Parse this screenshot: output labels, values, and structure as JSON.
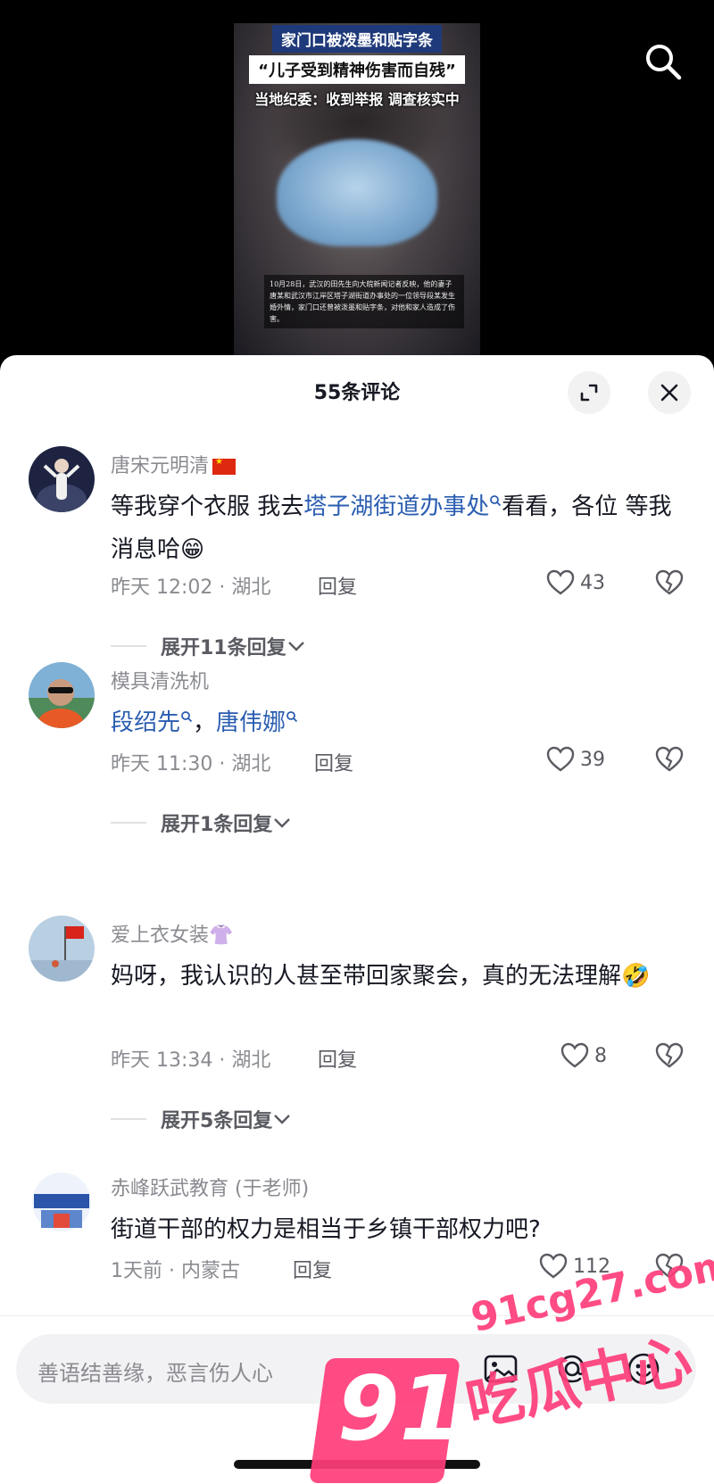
{
  "video": {
    "headline_1": "家门口被泼墨和贴字条",
    "headline_2": "“儿子受到精神伤害而自残”",
    "headline_3": "当地纪委：收到举报 调查核实中",
    "caption": "10月28日，武汉的田先生向大皖新闻记者反映，他的妻子唐某和武汉市江岸区塔子湖街道办事处的一位领导段某发生婚外情，家门口还曾被泼墨和贴字条，对他和家人造成了伤害。"
  },
  "sheet": {
    "title": "55条评论"
  },
  "comments": [
    {
      "username": "唐宋元明清",
      "text_pre": "等我穿个衣服 我去",
      "link_1": "塔子湖街道办事处",
      "text_mid": "看看，各位 等我消息哈",
      "emoji": "😁",
      "meta": "昨天 12:02 · 湖北",
      "reply_label": "回复",
      "likes": "43",
      "expand": "展开11条回复"
    },
    {
      "username": "模具清洗机",
      "link_1": "段绍先",
      "sep": "，",
      "link_2": "唐伟娜",
      "meta": "昨天 11:30 · 湖北",
      "reply_label": "回复",
      "likes": "39",
      "expand": "展开1条回复"
    },
    {
      "username": "爱上衣女装",
      "username_emoji": "👚",
      "text_pre": "妈呀，我认识的人甚至带回家聚会，真的无法理解",
      "emoji": "🤣",
      "meta": "昨天 13:34 · 湖北",
      "reply_label": "回复",
      "likes": "8",
      "expand": "展开5条回复"
    },
    {
      "username": "赤峰跃武教育 (于老师)",
      "text_pre": "街道干部的权力是相当于乡镇干部权力吧?",
      "meta": "1天前 · 内蒙古",
      "reply_label": "回复",
      "likes": "112"
    }
  ],
  "input": {
    "placeholder": "善语结善缘，恶言伤人心"
  },
  "watermark": {
    "number": "91",
    "url": "91cg27.com",
    "name": "吃瓜中心"
  },
  "colors": {
    "link": "#2a5db0",
    "watermark": "#ff3d7a"
  },
  "icons": [
    "search-icon",
    "expand-icon",
    "close-icon",
    "heart-icon",
    "dislike-icon",
    "image-icon",
    "at-icon",
    "emoji-icon",
    "china-flag-icon"
  ]
}
